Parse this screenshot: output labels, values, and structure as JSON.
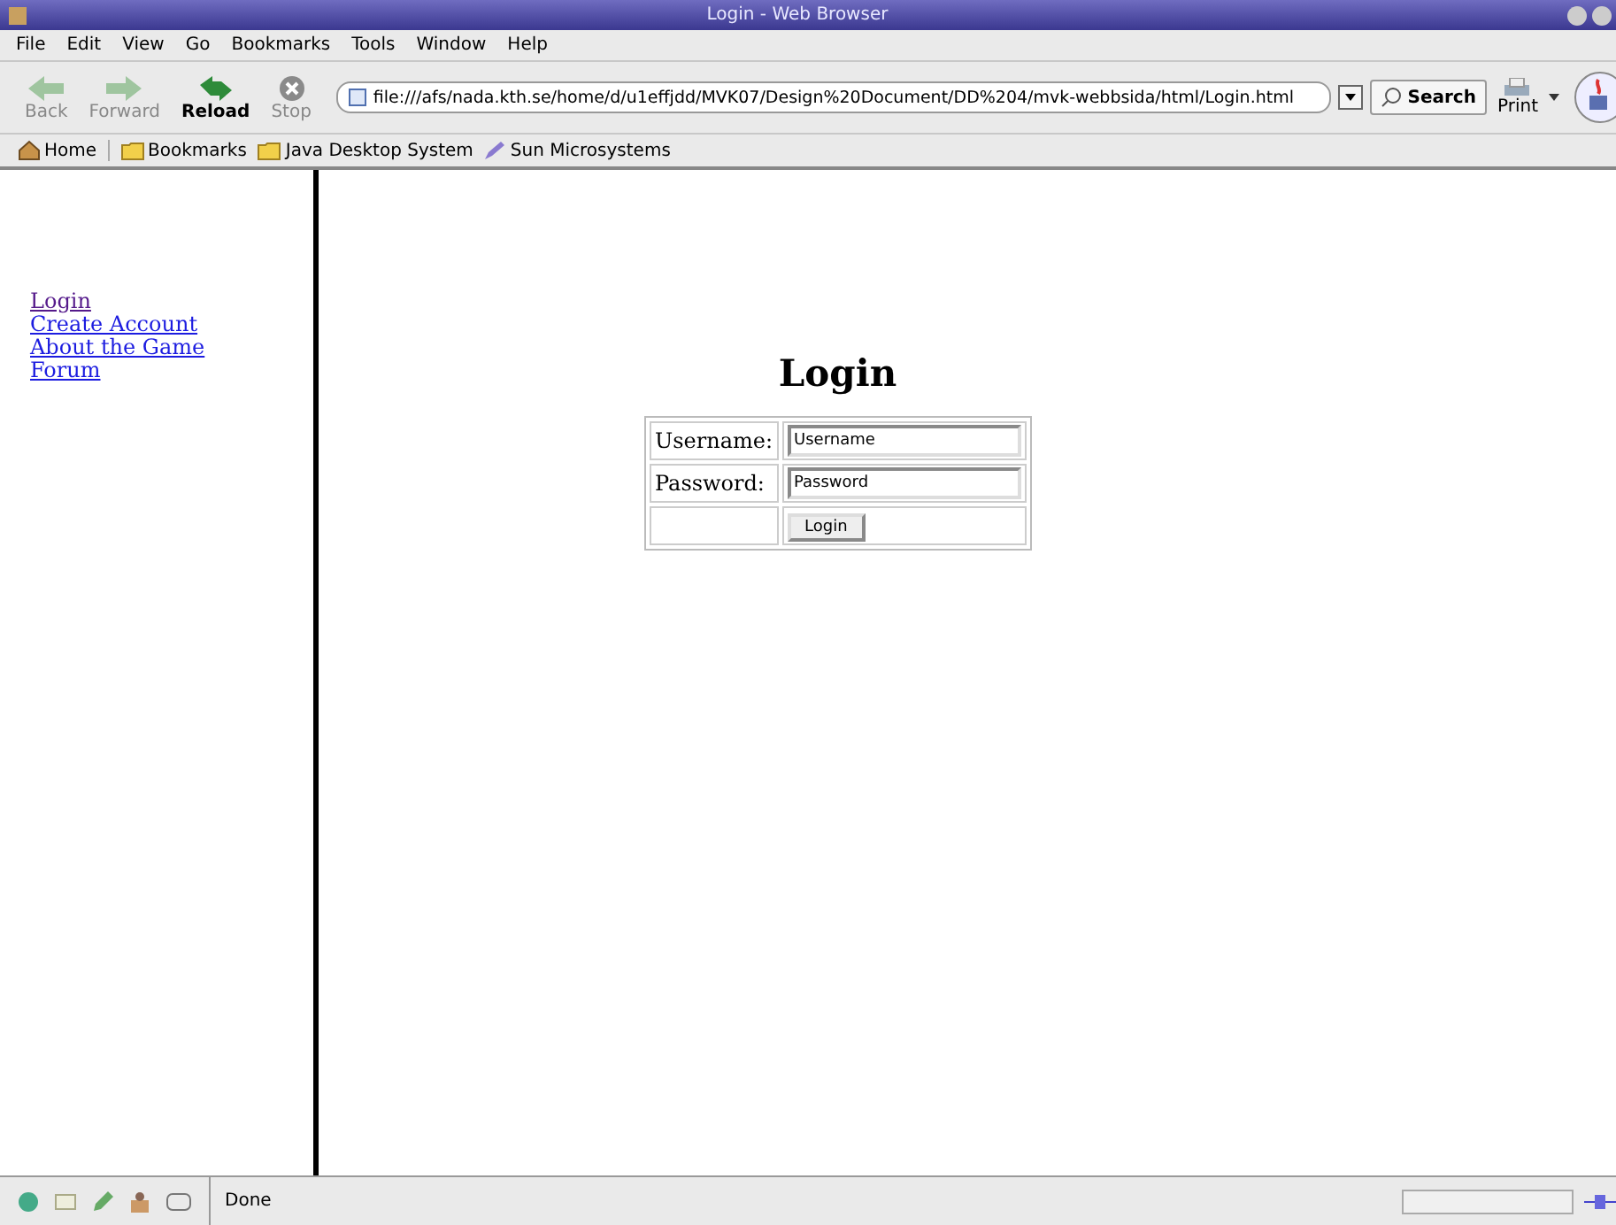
{
  "window": {
    "title": "Login - Web Browser"
  },
  "menu": [
    "File",
    "Edit",
    "View",
    "Go",
    "Bookmarks",
    "Tools",
    "Window",
    "Help"
  ],
  "toolbar": [
    {
      "kind": "back",
      "label": "Back",
      "disabled": true
    },
    {
      "kind": "forward",
      "label": "Forward",
      "disabled": true
    },
    {
      "kind": "reload",
      "label": "Reload",
      "disabled": false
    },
    {
      "kind": "stop",
      "label": "Stop",
      "disabled": true
    }
  ],
  "address": {
    "value": "file:///afs/nada.kth.se/home/d/u1effjdd/MVK07/Design%20Document/DD%204/mvk-webbsida/html/Login.html"
  },
  "search_button": "Search",
  "print_button": "Print",
  "bookmarks": [
    {
      "kind": "home",
      "label": "Home"
    },
    {
      "kind": "folder",
      "label": "Bookmarks"
    },
    {
      "kind": "folder",
      "label": "Java Desktop System"
    },
    {
      "kind": "pen",
      "label": "Sun Microsystems"
    }
  ],
  "sidebar": {
    "items": [
      {
        "label": "Login",
        "visited": true
      },
      {
        "label": "Create Account",
        "visited": false
      },
      {
        "label": "About the Game",
        "visited": false
      },
      {
        "label": "Forum",
        "visited": false
      }
    ]
  },
  "page": {
    "heading": "Login",
    "form": {
      "rows": [
        {
          "label": "Username:",
          "value": "Username"
        },
        {
          "label": "Password:",
          "value": "Password"
        }
      ],
      "button": "Login"
    }
  },
  "status_bar": {
    "text": "Done"
  }
}
